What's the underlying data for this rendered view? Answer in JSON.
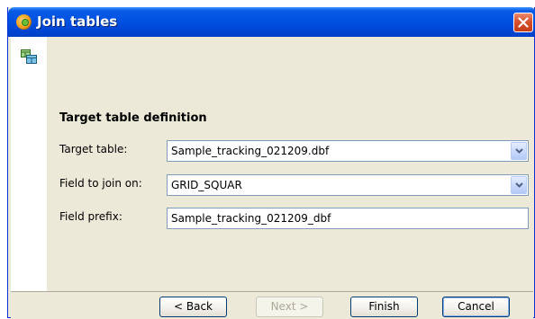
{
  "window": {
    "title": "Join tables",
    "icons": {
      "app": "app-globe-icon",
      "close": "close-icon",
      "wizard": "join-tables-icon",
      "dropdown": "chevron-down-icon"
    }
  },
  "form": {
    "section_title": "Target table definition",
    "target_table": {
      "label": "Target table:",
      "value": "Sample_tracking_021209.dbf"
    },
    "join_field": {
      "label": "Field to join on:",
      "value": "GRID_SQUAR"
    },
    "prefix": {
      "label": "Field prefix:",
      "value": "Sample_tracking_021209_dbf"
    }
  },
  "buttons": {
    "back": "< Back",
    "next": "Next >",
    "finish": "Finish",
    "cancel": "Cancel"
  },
  "colors": {
    "titlebar": "#0054e3",
    "dialog_bg": "#ece9d8",
    "close_button": "#d9502d"
  }
}
